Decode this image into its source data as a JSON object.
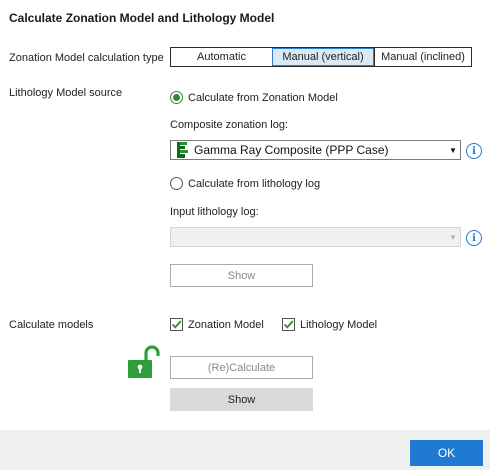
{
  "dialog": {
    "title": "Calculate Zonation Model and Lithology Model"
  },
  "zonation_type": {
    "label": "Zonation Model calculation type",
    "options": [
      "Automatic",
      "Manual (vertical)",
      "Manual (inclined)"
    ],
    "selected": "Manual (vertical)"
  },
  "lithology_source": {
    "label": "Lithology Model source",
    "option_zonation": "Calculate from Zonation Model",
    "composite_label": "Composite zonation log:",
    "composite_value": "Gamma Ray Composite (PPP Case)",
    "option_lithology_log": "Calculate from lithology log",
    "input_label": "Input lithology log:",
    "input_value": "",
    "show_button": "Show",
    "selected": "Calculate from Zonation Model"
  },
  "calculate_models": {
    "label": "Calculate models",
    "zonation_model": "Zonation Model",
    "zonation_checked": true,
    "lithology_model": "Lithology Model",
    "lithology_checked": true,
    "recalculate_button": "(Re)Calculate",
    "show_button": "Show"
  },
  "footer": {
    "ok_button": "OK"
  },
  "colors": {
    "accent": "#1f7ad1",
    "green": "#2e8b32",
    "footer_bg": "#f0f0f0"
  }
}
